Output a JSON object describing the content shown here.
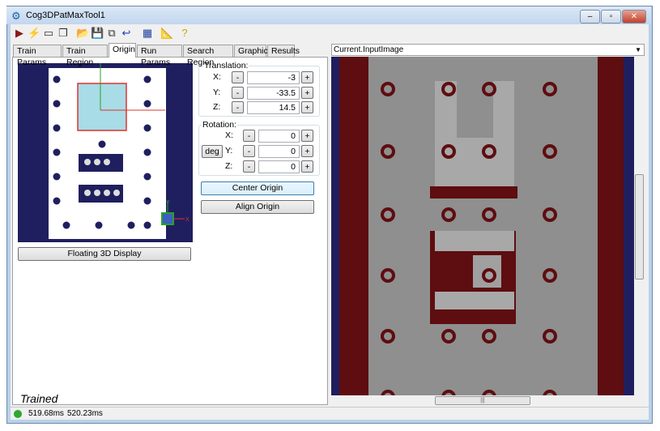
{
  "window": {
    "title": "Cog3DPatMaxTool1",
    "controls": [
      "–",
      "▫",
      "✕"
    ]
  },
  "toolbar": [
    {
      "icon": "run-icon",
      "glyph": "▶",
      "color": "#8b1a1a"
    },
    {
      "icon": "electric-icon",
      "glyph": "⚡",
      "color": "#c9a800"
    },
    {
      "icon": "show-image-icon",
      "glyph": "▭",
      "color": "#333"
    },
    {
      "icon": "floating-window-icon",
      "glyph": "❐",
      "color": "#333"
    },
    {
      "icon": "open-icon",
      "glyph": "📂",
      "color": "#c79a1a"
    },
    {
      "icon": "save-icon",
      "glyph": "💾",
      "color": "#222"
    },
    {
      "icon": "copy-icon",
      "glyph": "⧉",
      "color": "#333"
    },
    {
      "icon": "reset-icon",
      "glyph": "↩",
      "color": "#1a3fbf"
    },
    {
      "icon": "edit-icon",
      "glyph": "▦",
      "color": "#1a3f9f"
    },
    {
      "icon": "measure-icon",
      "glyph": "📐",
      "color": "#c9a800"
    },
    {
      "icon": "help-icon",
      "glyph": "?",
      "color": "#c9a800"
    }
  ],
  "tabs": [
    {
      "label": "Train Params",
      "active": false
    },
    {
      "label": "Train Region",
      "active": false
    },
    {
      "label": "Origin",
      "active": true
    },
    {
      "label": "Run Params",
      "active": false
    },
    {
      "label": "Search Region",
      "active": false
    },
    {
      "label": "Graphics",
      "active": false
    },
    {
      "label": "Results",
      "active": false
    }
  ],
  "origin": {
    "translation": {
      "label": "Translation:",
      "x_label": "X:",
      "y_label": "Y:",
      "z_label": "Z:",
      "x": "-3",
      "y": "-33.5",
      "z": "14.5"
    },
    "rotation": {
      "label": "Rotation:",
      "x_label": "X:",
      "y_label": "Y:",
      "z_label": "Z:",
      "x": "0",
      "y": "0",
      "z": "0",
      "unit_button": "deg"
    },
    "minus": "-",
    "plus": "+",
    "center_origin": "Center Origin",
    "align_origin": "Align Origin",
    "floating_display": "Floating 3D Display",
    "axis_x": "X",
    "axis_y": "Y"
  },
  "state": "Trained",
  "display": {
    "selector": "Current.InputImage"
  },
  "colors": {
    "navy": "#1f1f5f",
    "darkred": "#5e0d10",
    "gray": "#8f8f8f",
    "light": "#a8a8a8",
    "status_ok": "#2ea82e"
  },
  "status": {
    "time1": "519.68ms",
    "time2": "520.23ms"
  }
}
